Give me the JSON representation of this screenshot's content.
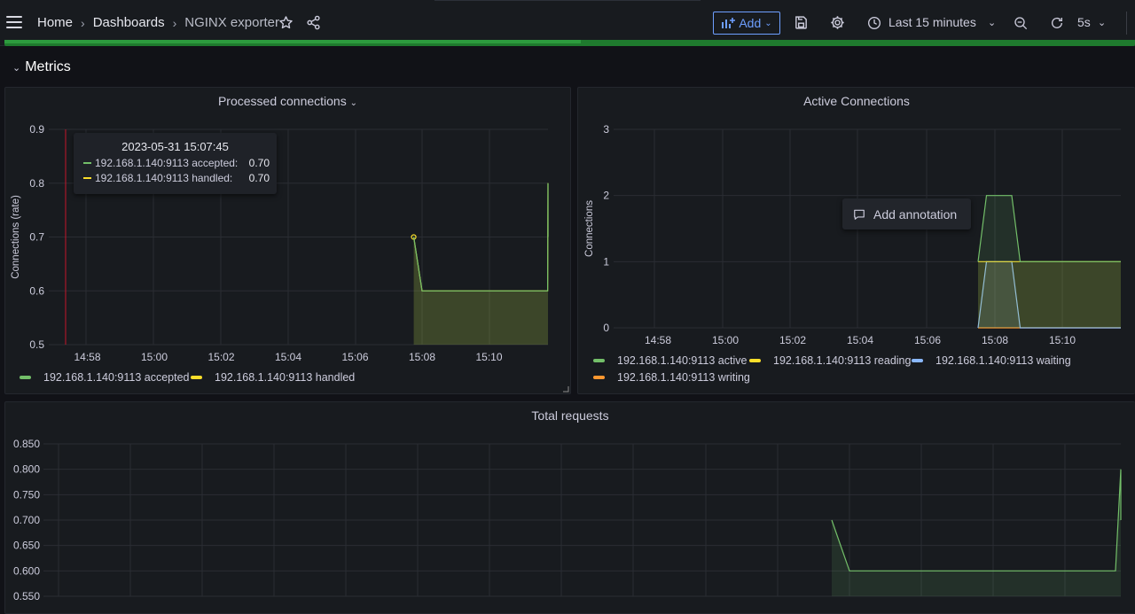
{
  "topbar": {
    "breadcrumb": [
      "Home",
      "Dashboards",
      "NGINX exporter"
    ],
    "add_label": "Add",
    "time_range": "Last 15 minutes",
    "refresh_interval": "5s"
  },
  "section": {
    "title": "Metrics"
  },
  "colors": {
    "green": "#73bf69",
    "yellow": "#fade2a",
    "cyan": "#8ab8ff",
    "orange": "#ff9830",
    "grid": "#2a2d33"
  },
  "panels": {
    "processed": {
      "title": "Processed connections",
      "legend": [
        "192.168.1.140:9113 accepted",
        "192.168.1.140:9113 handled"
      ],
      "tooltip": {
        "time": "2023-05-31 15:07:45",
        "rows": [
          {
            "label": "192.168.1.140:9113 accepted:",
            "value": "0.70"
          },
          {
            "label": "192.168.1.140:9113 handled:",
            "value": "0.70"
          }
        ]
      }
    },
    "active": {
      "title": "Active Connections",
      "legend": [
        "192.168.1.140:9113 active",
        "192.168.1.140:9113 reading",
        "192.168.1.140:9113 waiting",
        "192.168.1.140:9113 writing"
      ],
      "context_menu": "Add annotation"
    },
    "total": {
      "title": "Total requests"
    }
  },
  "chart_data": [
    {
      "type": "line",
      "title": "Processed connections",
      "ylabel": "Connections (rate)",
      "ylim": [
        0.5,
        0.9
      ],
      "yticks": [
        "0.5",
        "0.6",
        "0.7",
        "0.8",
        "0.9"
      ],
      "xticks": [
        "14:58",
        "15:00",
        "15:02",
        "15:04",
        "15:06",
        "15:08",
        "15:10"
      ],
      "series": [
        {
          "name": "192.168.1.140:9113 accepted",
          "x": [
            "15:07:45",
            "15:08:00",
            "15:08:15",
            "15:11:45",
            "15:12:00",
            "15:12:15"
          ],
          "values": [
            0.7,
            0.6,
            0.6,
            0.6,
            0.8,
            0.7
          ]
        },
        {
          "name": "192.168.1.140:9113 handled",
          "x": [
            "15:07:45",
            "15:08:00",
            "15:08:15",
            "15:11:45",
            "15:12:00",
            "15:12:15"
          ],
          "values": [
            0.7,
            0.6,
            0.6,
            0.6,
            0.8,
            0.7
          ]
        }
      ]
    },
    {
      "type": "line",
      "title": "Active Connections",
      "ylabel": "Connections",
      "ylim": [
        0,
        3
      ],
      "yticks": [
        "0",
        "1",
        "2",
        "3"
      ],
      "xticks": [
        "14:58",
        "15:00",
        "15:02",
        "15:04",
        "15:06",
        "15:08",
        "15:10"
      ],
      "series": [
        {
          "name": "192.168.1.140:9113 active",
          "x": [
            "15:07:30",
            "15:07:45",
            "15:08:30",
            "15:08:45",
            "15:12:15"
          ],
          "values": [
            1,
            2,
            2,
            1,
            1
          ]
        },
        {
          "name": "192.168.1.140:9113 reading",
          "x": [
            "15:07:30",
            "15:12:15"
          ],
          "values": [
            1,
            1
          ]
        },
        {
          "name": "192.168.1.140:9113 waiting",
          "x": [
            "15:07:30",
            "15:07:45",
            "15:08:30",
            "15:08:45",
            "15:12:15"
          ],
          "values": [
            0,
            1,
            1,
            0,
            0
          ]
        },
        {
          "name": "192.168.1.140:9113 writing",
          "x": [
            "15:07:30",
            "15:12:15"
          ],
          "values": [
            0,
            0
          ]
        }
      ]
    },
    {
      "type": "line",
      "title": "Total requests",
      "ylim": [
        0.55,
        0.85
      ],
      "yticks": [
        "0.550",
        "0.600",
        "0.650",
        "0.700",
        "0.750",
        "0.800",
        "0.850"
      ],
      "series": [
        {
          "name": "",
          "x": [
            "15:07:45",
            "15:08:00",
            "15:11:45",
            "15:12:00",
            "15:12:15"
          ],
          "values": [
            0.7,
            0.6,
            0.6,
            0.8,
            0.7
          ]
        }
      ]
    }
  ]
}
